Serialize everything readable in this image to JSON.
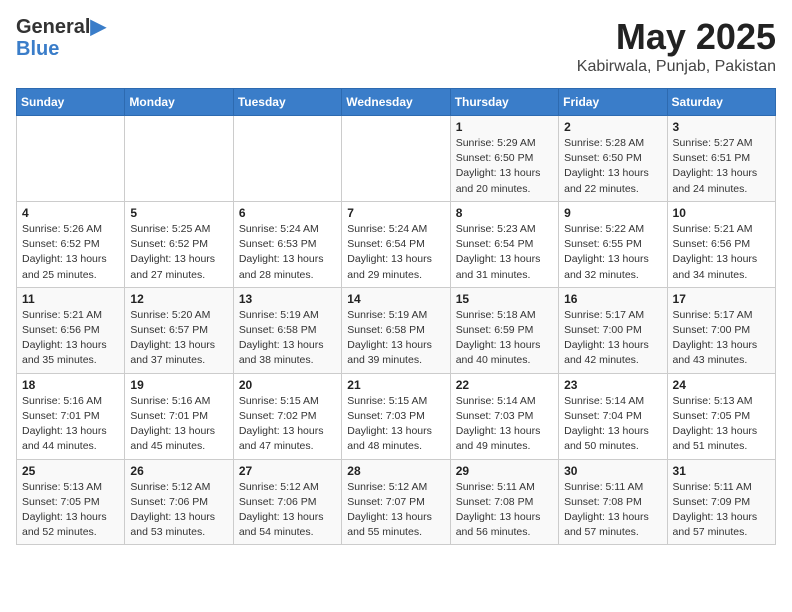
{
  "header": {
    "logo_line1": "General",
    "logo_line2": "Blue",
    "title": "May 2025",
    "location": "Kabirwala, Punjab, Pakistan"
  },
  "weekdays": [
    "Sunday",
    "Monday",
    "Tuesday",
    "Wednesday",
    "Thursday",
    "Friday",
    "Saturday"
  ],
  "weeks": [
    [
      {
        "day": "",
        "detail": ""
      },
      {
        "day": "",
        "detail": ""
      },
      {
        "day": "",
        "detail": ""
      },
      {
        "day": "",
        "detail": ""
      },
      {
        "day": "1",
        "detail": "Sunrise: 5:29 AM\nSunset: 6:50 PM\nDaylight: 13 hours\nand 20 minutes."
      },
      {
        "day": "2",
        "detail": "Sunrise: 5:28 AM\nSunset: 6:50 PM\nDaylight: 13 hours\nand 22 minutes."
      },
      {
        "day": "3",
        "detail": "Sunrise: 5:27 AM\nSunset: 6:51 PM\nDaylight: 13 hours\nand 24 minutes."
      }
    ],
    [
      {
        "day": "4",
        "detail": "Sunrise: 5:26 AM\nSunset: 6:52 PM\nDaylight: 13 hours\nand 25 minutes."
      },
      {
        "day": "5",
        "detail": "Sunrise: 5:25 AM\nSunset: 6:52 PM\nDaylight: 13 hours\nand 27 minutes."
      },
      {
        "day": "6",
        "detail": "Sunrise: 5:24 AM\nSunset: 6:53 PM\nDaylight: 13 hours\nand 28 minutes."
      },
      {
        "day": "7",
        "detail": "Sunrise: 5:24 AM\nSunset: 6:54 PM\nDaylight: 13 hours\nand 29 minutes."
      },
      {
        "day": "8",
        "detail": "Sunrise: 5:23 AM\nSunset: 6:54 PM\nDaylight: 13 hours\nand 31 minutes."
      },
      {
        "day": "9",
        "detail": "Sunrise: 5:22 AM\nSunset: 6:55 PM\nDaylight: 13 hours\nand 32 minutes."
      },
      {
        "day": "10",
        "detail": "Sunrise: 5:21 AM\nSunset: 6:56 PM\nDaylight: 13 hours\nand 34 minutes."
      }
    ],
    [
      {
        "day": "11",
        "detail": "Sunrise: 5:21 AM\nSunset: 6:56 PM\nDaylight: 13 hours\nand 35 minutes."
      },
      {
        "day": "12",
        "detail": "Sunrise: 5:20 AM\nSunset: 6:57 PM\nDaylight: 13 hours\nand 37 minutes."
      },
      {
        "day": "13",
        "detail": "Sunrise: 5:19 AM\nSunset: 6:58 PM\nDaylight: 13 hours\nand 38 minutes."
      },
      {
        "day": "14",
        "detail": "Sunrise: 5:19 AM\nSunset: 6:58 PM\nDaylight: 13 hours\nand 39 minutes."
      },
      {
        "day": "15",
        "detail": "Sunrise: 5:18 AM\nSunset: 6:59 PM\nDaylight: 13 hours\nand 40 minutes."
      },
      {
        "day": "16",
        "detail": "Sunrise: 5:17 AM\nSunset: 7:00 PM\nDaylight: 13 hours\nand 42 minutes."
      },
      {
        "day": "17",
        "detail": "Sunrise: 5:17 AM\nSunset: 7:00 PM\nDaylight: 13 hours\nand 43 minutes."
      }
    ],
    [
      {
        "day": "18",
        "detail": "Sunrise: 5:16 AM\nSunset: 7:01 PM\nDaylight: 13 hours\nand 44 minutes."
      },
      {
        "day": "19",
        "detail": "Sunrise: 5:16 AM\nSunset: 7:01 PM\nDaylight: 13 hours\nand 45 minutes."
      },
      {
        "day": "20",
        "detail": "Sunrise: 5:15 AM\nSunset: 7:02 PM\nDaylight: 13 hours\nand 47 minutes."
      },
      {
        "day": "21",
        "detail": "Sunrise: 5:15 AM\nSunset: 7:03 PM\nDaylight: 13 hours\nand 48 minutes."
      },
      {
        "day": "22",
        "detail": "Sunrise: 5:14 AM\nSunset: 7:03 PM\nDaylight: 13 hours\nand 49 minutes."
      },
      {
        "day": "23",
        "detail": "Sunrise: 5:14 AM\nSunset: 7:04 PM\nDaylight: 13 hours\nand 50 minutes."
      },
      {
        "day": "24",
        "detail": "Sunrise: 5:13 AM\nSunset: 7:05 PM\nDaylight: 13 hours\nand 51 minutes."
      }
    ],
    [
      {
        "day": "25",
        "detail": "Sunrise: 5:13 AM\nSunset: 7:05 PM\nDaylight: 13 hours\nand 52 minutes."
      },
      {
        "day": "26",
        "detail": "Sunrise: 5:12 AM\nSunset: 7:06 PM\nDaylight: 13 hours\nand 53 minutes."
      },
      {
        "day": "27",
        "detail": "Sunrise: 5:12 AM\nSunset: 7:06 PM\nDaylight: 13 hours\nand 54 minutes."
      },
      {
        "day": "28",
        "detail": "Sunrise: 5:12 AM\nSunset: 7:07 PM\nDaylight: 13 hours\nand 55 minutes."
      },
      {
        "day": "29",
        "detail": "Sunrise: 5:11 AM\nSunset: 7:08 PM\nDaylight: 13 hours\nand 56 minutes."
      },
      {
        "day": "30",
        "detail": "Sunrise: 5:11 AM\nSunset: 7:08 PM\nDaylight: 13 hours\nand 57 minutes."
      },
      {
        "day": "31",
        "detail": "Sunrise: 5:11 AM\nSunset: 7:09 PM\nDaylight: 13 hours\nand 57 minutes."
      }
    ]
  ]
}
